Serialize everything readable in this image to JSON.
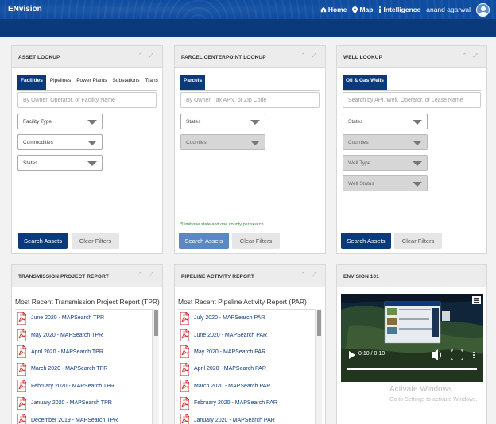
{
  "header": {
    "brand": "ENvision",
    "nav": {
      "home": "Home",
      "map": "Map",
      "intelligence": "Intelligence",
      "user": "anand agarwal"
    }
  },
  "asset_lookup": {
    "title": "ASSET LOOKUP",
    "tabs": [
      "Facilities",
      "Pipelines",
      "Power Plants",
      "Substations",
      "Transmi"
    ],
    "search_placeholder": "By Owner, Operator, or Facility Name",
    "dropdowns": [
      "Facility Type",
      "Commodities",
      "States"
    ],
    "search_button": "Search Assets",
    "clear_button": "Clear Filters"
  },
  "parcel_lookup": {
    "title": "PARCEL CENTERPOINT LOOKUP",
    "tabs": [
      "Parcels"
    ],
    "search_placeholder": "By Owner, Tax APN, or Zip Code",
    "dropdowns": [
      "States",
      "Counties"
    ],
    "note": "*Limit one state and one county per search",
    "search_button": "Search Assets",
    "clear_button": "Clear Filters"
  },
  "well_lookup": {
    "title": "WELL LOOKUP",
    "tabs": [
      "Oil & Gas Wells"
    ],
    "search_placeholder": "Search by API, Well, Operator, or Lease Name",
    "dropdowns": [
      "States",
      "Counties",
      "Well Type",
      "Well Status"
    ],
    "search_button": "Search Assets",
    "clear_button": "Clear Filters"
  },
  "tpr": {
    "title": "TRANSMISSION PROJECT REPORT",
    "heading": "Most Recent Transmission Project Report (TPR)",
    "reports": [
      "June 2020 - MAPSearch TPR",
      "May 2020 - MAPSearch TPR",
      "April 2020 - MAPSearch TPR",
      "March 2020 - MAPSearch TPR",
      "February 2020 - MAPSearch TPR",
      "January 2020 - MAPSearch TPR",
      "December 2019 - MAPSearch TPR"
    ]
  },
  "par": {
    "title": "PIPELINE ACTIVITY REPORT",
    "heading": "Most Recent Pipeline Activity Report (PAR)",
    "reports": [
      "July 2020 - MAPSearch PAR",
      "June 2020 - MAPSearch PAR",
      "May 2020 - MAPSearch PAR",
      "April 2020 - MAPSearch PAR",
      "March 2020 - MAPSearch PAR",
      "February 2020 - MAPSearch PAR",
      "January 2020 - MAPSearch PAR"
    ]
  },
  "envision101": {
    "title": "ENVISION 101",
    "video_time": "0:10 / 0:10",
    "video_progress": 1.0,
    "watermark_line1": "Activate Windows",
    "watermark_line2": "Go to Settings to activate Windows."
  },
  "colors": {
    "brand_blue": "#0f4da1",
    "dark_blue": "#0b3a7b",
    "note_green": "#2a8a2a"
  }
}
